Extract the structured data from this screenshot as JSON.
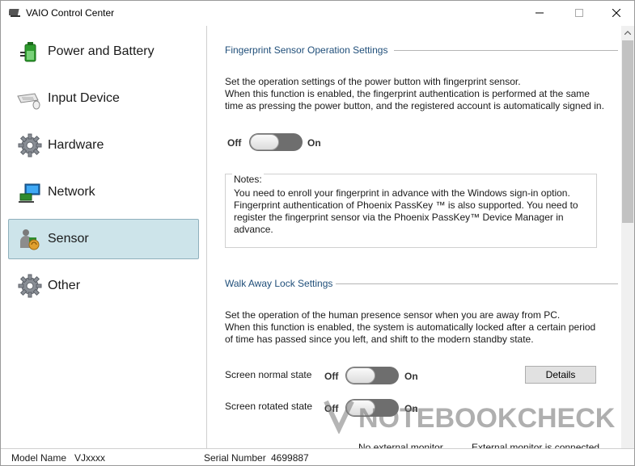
{
  "window": {
    "title": "VAIO Control Center"
  },
  "sidebar": {
    "items": [
      {
        "label": "Power and Battery",
        "icon": "battery-plug-icon",
        "active": false
      },
      {
        "label": "Input Device",
        "icon": "keyboard-mouse-icon",
        "active": false
      },
      {
        "label": "Hardware",
        "icon": "gear-icon",
        "active": false
      },
      {
        "label": "Network",
        "icon": "network-icon",
        "active": false
      },
      {
        "label": "Sensor",
        "icon": "sensor-person-icon",
        "active": true
      },
      {
        "label": "Other",
        "icon": "gear-icon",
        "active": false
      }
    ]
  },
  "fingerprint": {
    "title": "Fingerprint Sensor Operation Settings",
    "desc_1": "Set the operation settings of the power button with fingerprint sensor.",
    "desc_2": "When this function is enabled, the fingerprint authentication is performed at the same time as pressing the power button, and the registered account is automatically signed in.",
    "off_label": "Off",
    "on_label": "On",
    "notes_title": "Notes:",
    "notes_text": "You need to enroll your fingerprint in advance with the Windows sign-in option. Fingerprint authentication of Phoenix PassKey ™ is also supported. You need to register the fingerprint sensor via the Phoenix PassKey™ Device Manager in advance."
  },
  "walkaway": {
    "title": "Walk Away Lock Settings",
    "desc_1": "Set the operation of the human presence sensor when you are away from PC.",
    "desc_2": "When this function is enabled, the system is automatically locked after a certain period of time has passed since you left, and shift to the modern standby state.",
    "normal_label": "Screen normal state",
    "rotated_label": "Screen rotated state",
    "off_label": "Off",
    "on_label": "On",
    "details_label": "Details",
    "col_no_monitor": "No external monitor",
    "col_monitor": "External monitor is connected"
  },
  "status": {
    "model_label": "Model Name",
    "model_value": "VJxxxx",
    "serial_label": "Serial Number",
    "serial_value": "4699887"
  },
  "watermark": {
    "text": "NOTEBOOKCHECK"
  },
  "colors": {
    "accent_title": "#1f4e79",
    "active_item_bg": "#cde4ea"
  }
}
